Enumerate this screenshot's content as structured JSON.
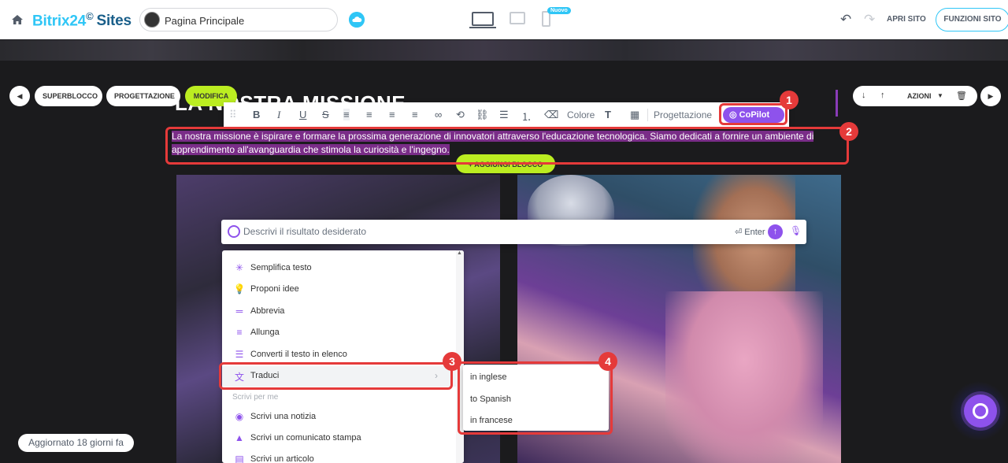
{
  "topbar": {
    "brand_name": "Bitrix24",
    "brand_mark": "©",
    "brand_suffix": "Sites",
    "page_name": "Pagina Principale",
    "mobile_badge": "Nuovo",
    "open_site": "APRI SITO",
    "site_features": "FUNZIONI SITO",
    "icons": [
      "home-icon",
      "cloud-icon",
      "desktop-icon",
      "tablet-icon",
      "mobile-icon",
      "undo-icon",
      "redo-icon"
    ]
  },
  "block_controls": {
    "superblock": "SUPERBLOCCO",
    "design": "PROGETTAZIONE",
    "edit": "MODIFICA",
    "actions": "AZIONI",
    "add_block": "AGGIUNGI BLOCCO"
  },
  "block": {
    "title": "LA NOSTRA MISSIONE",
    "text": "La nostra missione è ispirare e formare la prossima generazione di innovatori attraverso l'educazione tecnologica. Siamo dedicati a fornire un ambiente di apprendimento all'avanguardia che stimola la curiosità e l'ingegno."
  },
  "format_toolbar": {
    "color": "Colore",
    "design": "Progettazione",
    "copilot": "CoPilot"
  },
  "copilot_prompt": {
    "placeholder": "Descrivi il risultato desiderato",
    "enter_hint": "Enter"
  },
  "copilot_menu": {
    "items": [
      {
        "label": "Semplifica testo",
        "icon": "sparkle-icon"
      },
      {
        "label": "Proponi idee",
        "icon": "bulb-icon"
      },
      {
        "label": "Abbrevia",
        "icon": "shorten-icon"
      },
      {
        "label": "Allunga",
        "icon": "lengthen-icon"
      },
      {
        "label": "Converti il testo in elenco",
        "icon": "list-icon"
      },
      {
        "label": "Traduci",
        "icon": "translate-icon"
      }
    ],
    "section_label": "Scrivi per me",
    "write_items": [
      {
        "label": "Scrivi una notizia",
        "icon": "broadcast-icon"
      },
      {
        "label": "Scrivi un comunicato stampa",
        "icon": "bell-icon"
      },
      {
        "label": "Scrivi un articolo",
        "icon": "document-icon"
      }
    ]
  },
  "translate_submenu": [
    "in inglese",
    "to Spanish",
    "in francese"
  ],
  "annotations": [
    "1",
    "2",
    "3",
    "4"
  ],
  "footer": {
    "updated": "Aggiornato 18 giorni fa"
  },
  "colors": {
    "accent_blue": "#2fc6f6",
    "copilot_purple": "#8e52ec",
    "lime": "#bbed21",
    "annotation_red": "#e53a3a",
    "selection": "#7a2d88"
  }
}
